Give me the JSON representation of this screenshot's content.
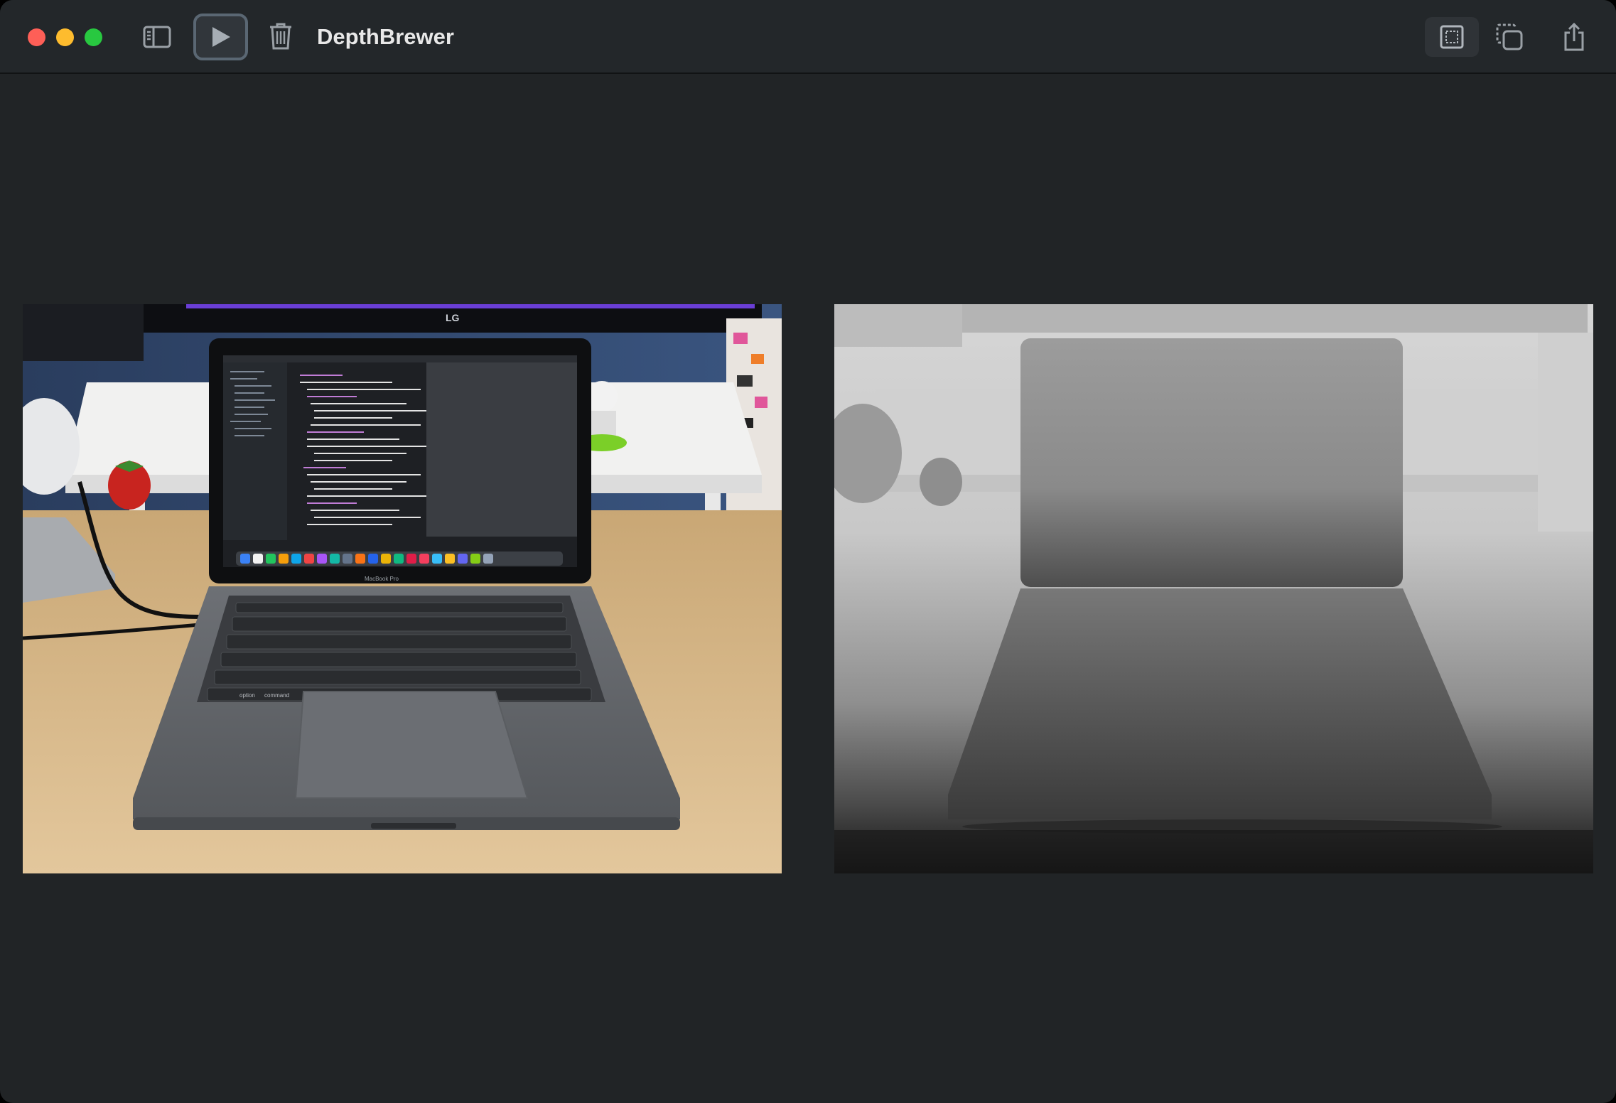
{
  "window": {
    "title": "DepthBrewer"
  },
  "toolbar": {
    "items": [
      {
        "name": "toggle-sidebar",
        "icon": "sidebar-left-icon"
      },
      {
        "name": "run",
        "icon": "play-icon"
      },
      {
        "name": "delete",
        "icon": "trash-icon"
      }
    ],
    "right_items": [
      {
        "name": "fit-view",
        "icon": "viewfinder-icon"
      },
      {
        "name": "duplicate",
        "icon": "copy-icon"
      },
      {
        "name": "share",
        "icon": "share-icon"
      }
    ]
  },
  "content": {
    "source_image": {
      "icon": "photo-laptop-on-desk",
      "screen_brand": "LG",
      "laptop_label": "MacBook Pro",
      "key_labels": [
        "option",
        "command",
        "command"
      ]
    },
    "depth_map": {
      "icon": "grayscale-depth-map"
    }
  },
  "colors": {
    "window_bg": "#212426",
    "titlebar_bg": "#23272a",
    "close": "#fe5f57",
    "minimize": "#febc2e",
    "zoom": "#28c840"
  }
}
